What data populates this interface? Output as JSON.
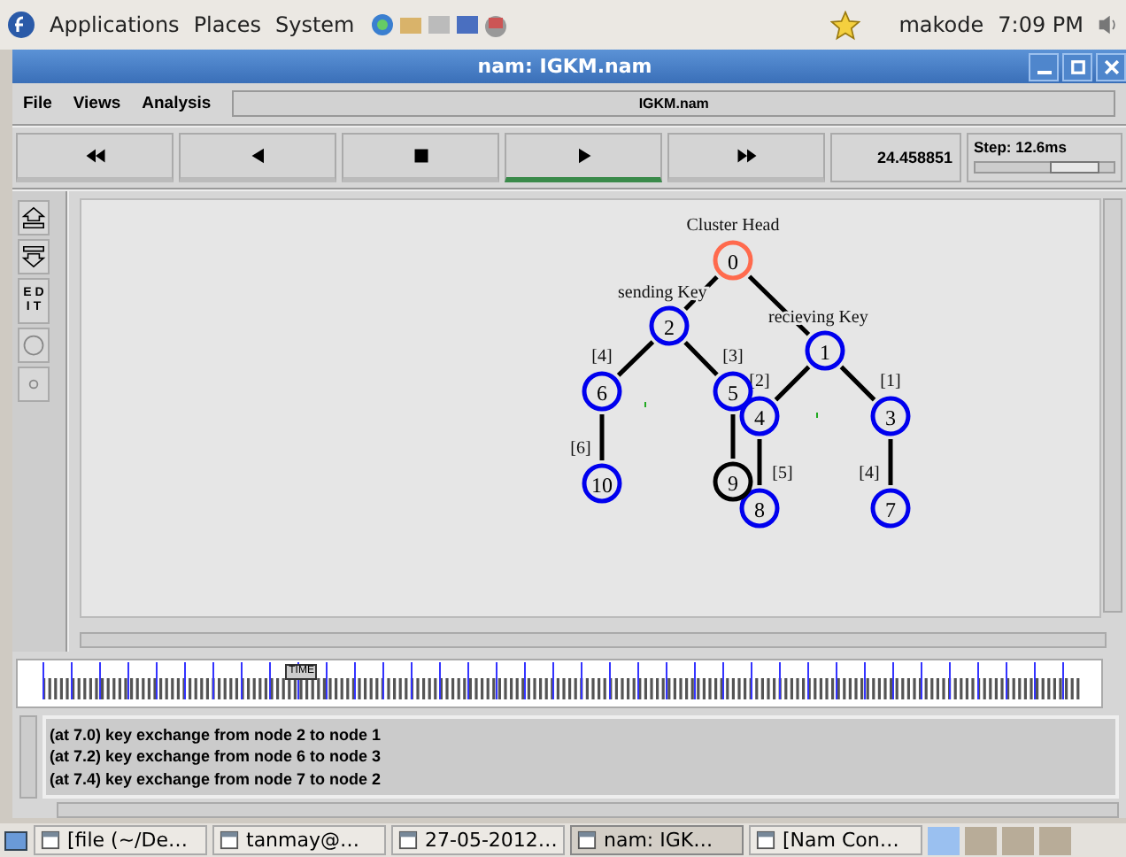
{
  "top_panel": {
    "menus": [
      "Applications",
      "Places",
      "System"
    ],
    "user": "makode",
    "clock": "7:09 PM"
  },
  "window": {
    "title": "nam: IGKM.nam"
  },
  "menu_bar": {
    "items": [
      "File",
      "Views",
      "Analysis"
    ],
    "file_name": "IGKM.nam"
  },
  "controls": {
    "buttons": [
      {
        "kind": "rewind",
        "selected": false
      },
      {
        "kind": "back",
        "selected": false
      },
      {
        "kind": "stop",
        "selected": false
      },
      {
        "kind": "play",
        "selected": true
      },
      {
        "kind": "forward",
        "selected": false
      }
    ],
    "time": "24.458851",
    "step": "Step: 12.6ms",
    "level": 0.7
  },
  "tools": [
    {
      "kind": "zoom-in"
    },
    {
      "kind": "zoom-out"
    },
    {
      "kind": "edit",
      "label": "EDIT"
    },
    {
      "kind": "circle"
    },
    {
      "kind": "dot"
    }
  ],
  "network": {
    "nodes": [
      {
        "label": "0",
        "color": "#ff6a4d"
      },
      {
        "label": "1",
        "color": "#0000ee"
      },
      {
        "label": "2",
        "color": "#0000ee"
      },
      {
        "label": "3",
        "color": "#0000ee"
      },
      {
        "label": "4",
        "color": "#0000ee"
      },
      {
        "label": "5",
        "color": "#0000ee"
      },
      {
        "label": "6",
        "color": "#0000ee"
      },
      {
        "label": "7",
        "color": "#0000ee"
      },
      {
        "label": "8",
        "color": "#0000ee"
      },
      {
        "label": "9",
        "color": "#000000"
      },
      {
        "label": "10",
        "color": "#0000ee"
      }
    ],
    "annotations": [
      "Cluster Head",
      "sending Key",
      "recieving Key"
    ],
    "link_labels": [
      "[4]",
      "[3]",
      "[2]",
      "[1]",
      "[6]",
      "[5]",
      "[4]"
    ]
  },
  "timeline": {
    "marker": "TIME",
    "level": 0.26
  },
  "log": {
    "lines": [
      "(at 7.0) key exchange from node 2 to node 1",
      "(at 7.2) key exchange from node 6 to node 3",
      "(at 7.4) key exchange from node 7 to node 2"
    ]
  },
  "taskbar": {
    "tasks": [
      {
        "label": "[file (~/De…",
        "selected": false
      },
      {
        "label": "tanmay@…",
        "selected": false
      },
      {
        "label": "27-05-2012…",
        "selected": false
      },
      {
        "label": "nam: IGK…",
        "selected": true
      },
      {
        "label": "[Nam Con…",
        "selected": false
      }
    ]
  }
}
